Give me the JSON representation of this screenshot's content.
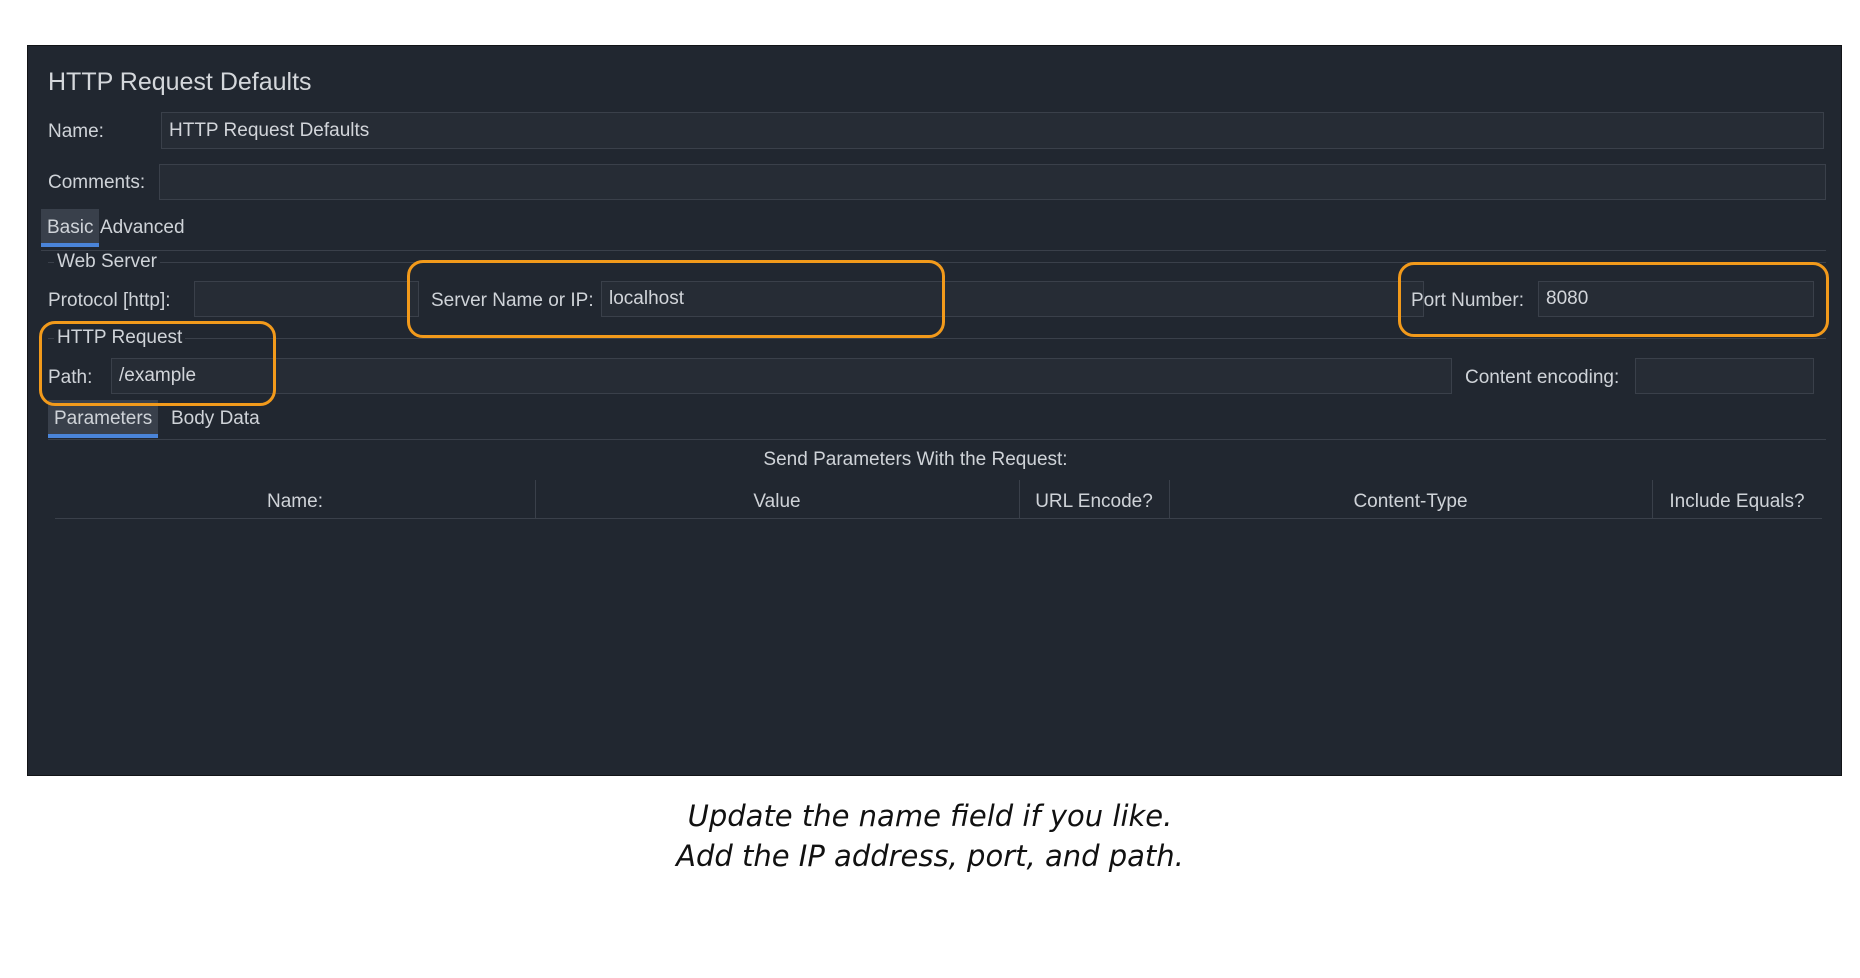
{
  "panel": {
    "title": "HTTP Request Defaults",
    "name_label": "Name:",
    "name_value": "HTTP Request Defaults",
    "comments_label": "Comments:",
    "comments_value": "",
    "tabs": [
      "Basic",
      "Advanced"
    ],
    "web_server": {
      "legend": "Web Server",
      "protocol_label": "Protocol [http]:",
      "protocol_value": "",
      "server_label": "Server Name or IP:",
      "server_value": "localhost",
      "port_label": "Port Number:",
      "port_value": "8080"
    },
    "http_request": {
      "legend": "HTTP Request",
      "path_label": "Path:",
      "path_value": "/example",
      "encoding_label": "Content encoding:",
      "encoding_value": ""
    },
    "sub_tabs": [
      "Parameters",
      "Body Data"
    ],
    "params_title": "Send Parameters With the Request:",
    "columns": [
      "Name:",
      "Value",
      "URL Encode?",
      "Content-Type",
      "Include Equals?"
    ]
  },
  "highlight_color": "#f29a1b",
  "caption": {
    "line1": "Update the name field if you like.",
    "line2": "Add the IP address, port, and path."
  }
}
